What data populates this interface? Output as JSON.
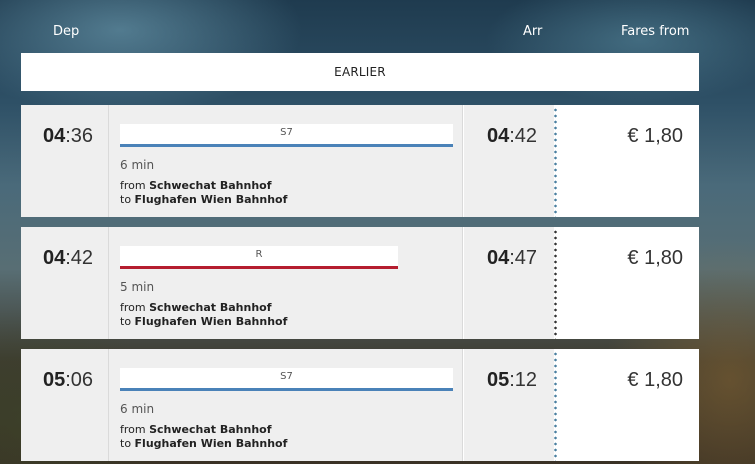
{
  "header": {
    "dep_label": "Dep",
    "arr_label": "Arr",
    "fare_label": "Fares from"
  },
  "earlier_button": "EARLIER",
  "connections": [
    {
      "dep_hour": "04",
      "dep_min": ":36",
      "line": "S7",
      "line_color": "#4a82b8",
      "duration": "6 min",
      "from_prefix": "from ",
      "from": "Schwechat Bahnhof",
      "to_prefix": "to ",
      "to": "Flughafen Wien Bahnhof",
      "arr_hour": "04",
      "arr_min": ":42",
      "fare": "€ 1,80",
      "dot_color": "#4a7fa0"
    },
    {
      "dep_hour": "04",
      "dep_min": ":42",
      "line": "R",
      "line_color": "#b51d2f",
      "duration": "5 min",
      "from_prefix": "from ",
      "from": "Schwechat Bahnhof",
      "to_prefix": "to ",
      "to": "Flughafen Wien Bahnhof",
      "arr_hour": "04",
      "arr_min": ":47",
      "fare": "€ 1,80",
      "dot_color": "#333333"
    },
    {
      "dep_hour": "05",
      "dep_min": ":06",
      "line": "S7",
      "line_color": "#4a82b8",
      "duration": "6 min",
      "from_prefix": "from ",
      "from": "Schwechat Bahnhof",
      "to_prefix": "to ",
      "to": "Flughafen Wien Bahnhof",
      "arr_hour": "05",
      "arr_min": ":12",
      "fare": "€ 1,80",
      "dot_color": "#4a7fa0"
    }
  ]
}
